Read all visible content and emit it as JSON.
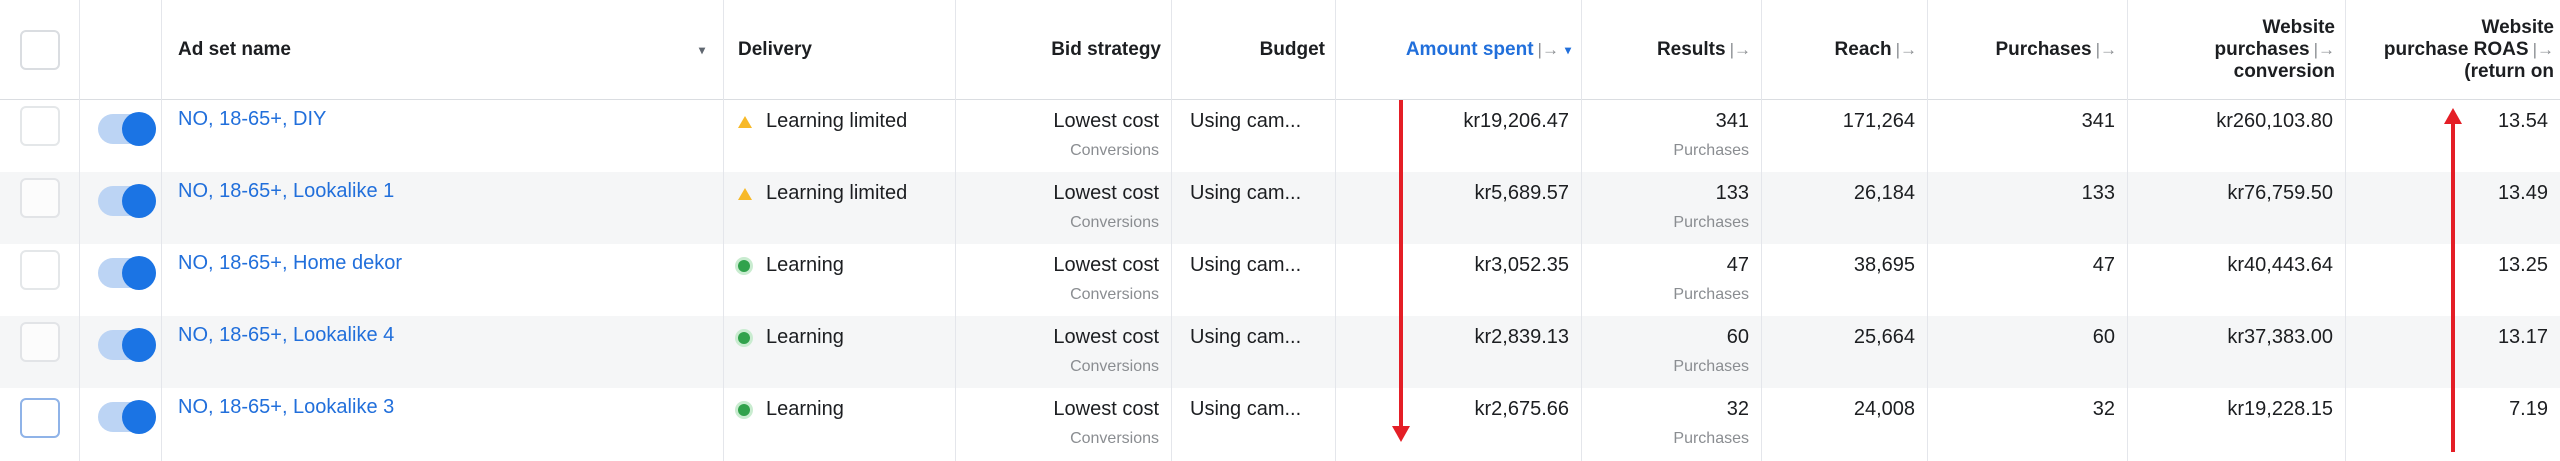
{
  "header": {
    "name": "Ad set name",
    "delivery": "Delivery",
    "bid_strategy": "Bid strategy",
    "budget": "Budget",
    "amount_spent": "Amount spent",
    "results": "Results",
    "reach": "Reach",
    "purchases": "Purchases",
    "website_purchases_line1": "Website",
    "website_purchases_line2": "purchases",
    "website_purchases_line3": "conversion",
    "roas_line1": "Website",
    "roas_line2": "purchase ROAS",
    "roas_line3": "(return on",
    "column_icon": "|→",
    "sort_caret": "▾"
  },
  "rows": [
    {
      "name": "NO, 18-65+, DIY",
      "delivery": "Learning limited",
      "delivery_status": "learning-limited",
      "bid": "Lowest cost",
      "bid_sub": "Conversions",
      "budget": "Using cam...",
      "amount": "kr19,206.47",
      "results": "341",
      "results_sub": "Purchases",
      "reach": "171,264",
      "purchases": "341",
      "website_purchases": "kr260,103.80",
      "roas": "13.54"
    },
    {
      "name": "NO, 18-65+, Lookalike 1",
      "delivery": "Learning limited",
      "delivery_status": "learning-limited",
      "bid": "Lowest cost",
      "bid_sub": "Conversions",
      "budget": "Using cam...",
      "amount": "kr5,689.57",
      "results": "133",
      "results_sub": "Purchases",
      "reach": "26,184",
      "purchases": "133",
      "website_purchases": "kr76,759.50",
      "roas": "13.49"
    },
    {
      "name": "NO, 18-65+, Home dekor",
      "delivery": "Learning",
      "delivery_status": "learning",
      "bid": "Lowest cost",
      "bid_sub": "Conversions",
      "budget": "Using cam...",
      "amount": "kr3,052.35",
      "results": "47",
      "results_sub": "Purchases",
      "reach": "38,695",
      "purchases": "47",
      "website_purchases": "kr40,443.64",
      "roas": "13.25"
    },
    {
      "name": "NO, 18-65+, Lookalike 4",
      "delivery": "Learning",
      "delivery_status": "learning",
      "bid": "Lowest cost",
      "bid_sub": "Conversions",
      "budget": "Using cam...",
      "amount": "kr2,839.13",
      "results": "60",
      "results_sub": "Purchases",
      "reach": "25,664",
      "purchases": "60",
      "website_purchases": "kr37,383.00",
      "roas": "13.17"
    },
    {
      "name": "NO, 18-65+, Lookalike 3",
      "delivery": "Learning",
      "delivery_status": "learning",
      "bid": "Lowest cost",
      "bid_sub": "Conversions",
      "budget": "Using cam...",
      "amount": "kr2,675.66",
      "results": "32",
      "results_sub": "Purchases",
      "reach": "24,008",
      "purchases": "32",
      "website_purchases": "kr19,228.15",
      "roas": "7.19"
    }
  ],
  "colors": {
    "link": "#216fdb",
    "toggle_on": "#1b74e4",
    "learning_limited": "#f7b928",
    "learning": "#31a24c",
    "annotation_arrow": "#e41e26",
    "row_alt": "#f5f6f7"
  }
}
